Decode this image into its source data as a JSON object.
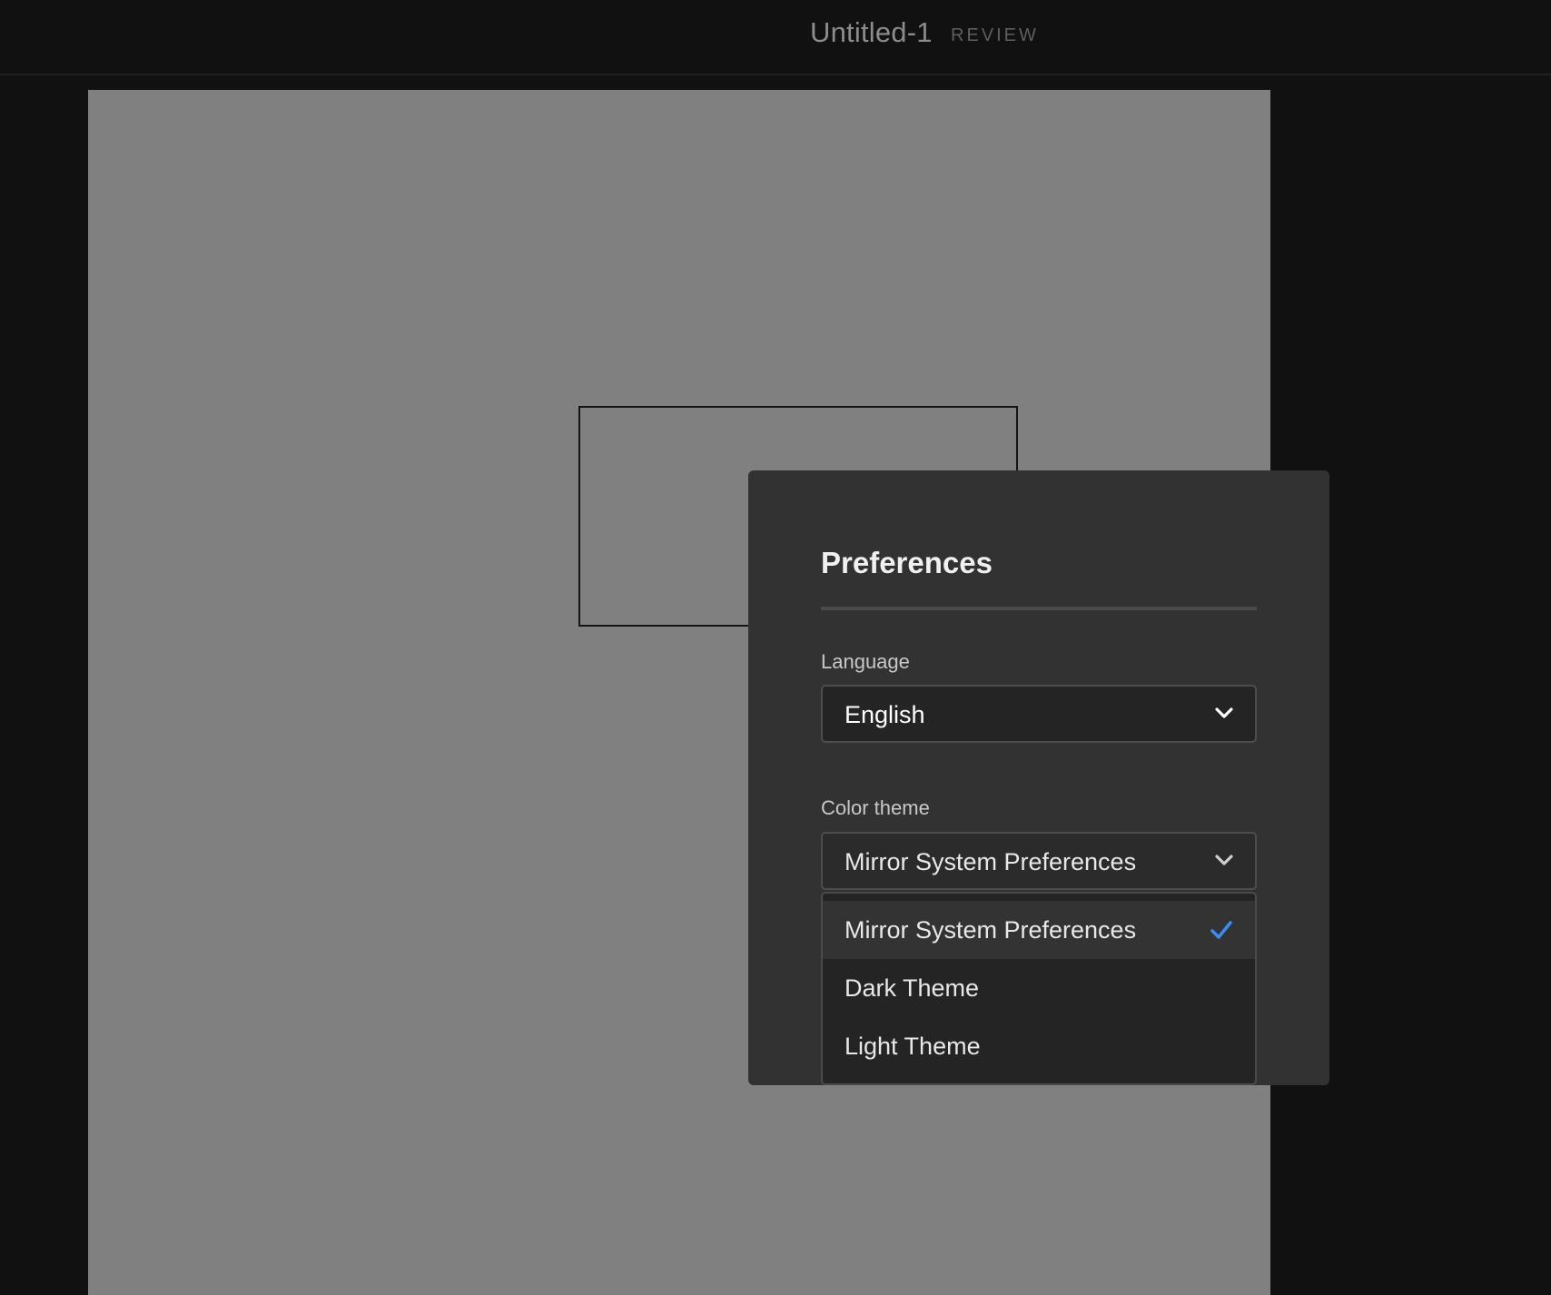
{
  "header": {
    "document_title": "Untitled-1",
    "mode_label": "REVIEW"
  },
  "preferences": {
    "title": "Preferences",
    "language": {
      "label": "Language",
      "selected": "English",
      "icon": "chevron-down-icon"
    },
    "color_theme": {
      "label": "Color theme",
      "selected": "Mirror System Preferences",
      "icon": "chevron-down-icon",
      "options": [
        {
          "label": "Mirror System Preferences",
          "checked": true
        },
        {
          "label": "Dark Theme",
          "checked": false
        },
        {
          "label": "Light Theme",
          "checked": false
        }
      ]
    }
  },
  "colors": {
    "accent_check": "#378ef0",
    "background": "#111111",
    "canvas": "#808080",
    "dialog": "#323232"
  }
}
